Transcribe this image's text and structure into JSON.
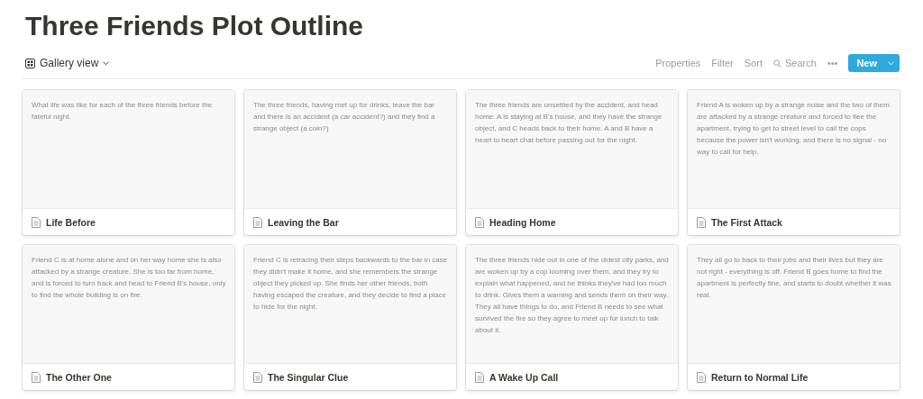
{
  "title": "Three Friends Plot Outline",
  "view": {
    "label": "Gallery view"
  },
  "toolbar": {
    "actions": [
      "Properties",
      "Filter",
      "Sort"
    ],
    "search": "Search",
    "more": "•••",
    "new_button": "New"
  },
  "cards": [
    {
      "description": "What life was like for each of the three friends before the fateful night.",
      "title": "Life Before"
    },
    {
      "description": "The three friends, having met up for drinks, leave the bar and there is an accident (a car accident?) and they find a strange object (a coin?)",
      "title": "Leaving the Bar"
    },
    {
      "description": "The three friends are unsettled by the accident, and head home. A is staying at B's house, and they have the strange object, and C heads back to their home. A and B have a heart to heart chat before passing out for the night.",
      "title": "Heading Home"
    },
    {
      "description": "Friend A is woken up by a strange noise and the two of them are attacked by a strange creature and forced to flee the apartment, trying to get to street level to call the cops because the power isn't working, and there is no signal - no way to call for help.",
      "title": "The First Attack"
    },
    {
      "description": "Friend C is at home alone and on her way home she is also attacked by a strange creature. She is too far from home, and is forced to turn back and head to Friend B's house, only to find the whole building is on fire.",
      "title": "The Other One"
    },
    {
      "description": "Friend C is retracing their steps backwards to the bar in case they didn't make it home, and she remembers the strange object they picked up. She finds her other friends, both having escaped the creature, and they decide to find a place to hide for the night.",
      "title": "The Singular Clue"
    },
    {
      "description": "The three friends hide out in one of the oldest city parks, and are woken up by a cop looming over them, and they try to explain what happened, and he thinks they've had too much to drink. Gives them a warning and sends them on their way. They all have things to do, and Friend B needs to see what survived the fire so they agree to meet up for lunch to talk about it.",
      "title": "A Wake Up Call"
    },
    {
      "description": "They all go to back to their jobs and their lives but they are not right - everything is off. Friend B goes home to find the apartment is perfectly fine, and starts to doubt whether it was real.",
      "title": "Return to Normal Life"
    }
  ]
}
